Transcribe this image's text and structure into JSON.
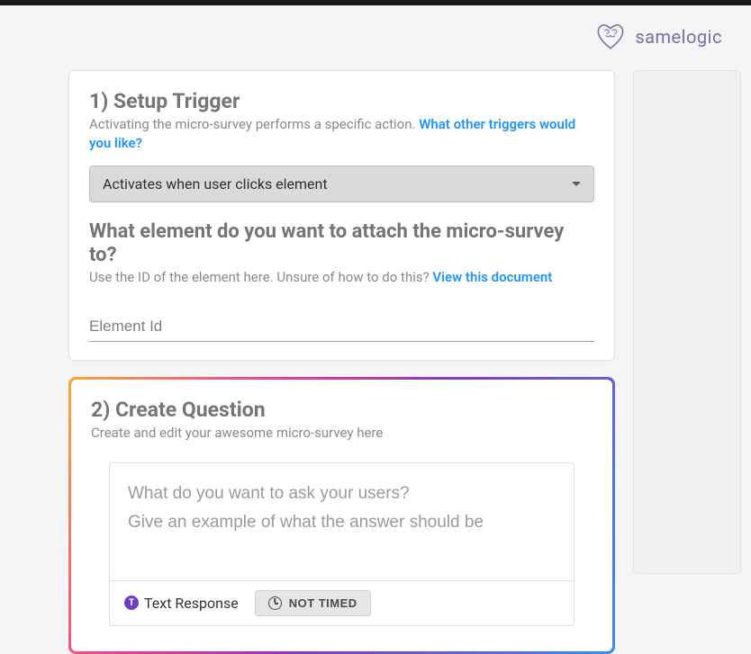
{
  "brand": "samelogic",
  "step1": {
    "title": "1) Setup Trigger",
    "desc": "Activating the micro-survey performs a specific action. ",
    "link": "What other triggers would you like?",
    "dropdown_selected": "Activates when user clicks element",
    "element_header": "What element do you want to attach the micro-survey to?",
    "element_desc": "Use the ID of the element here. Unsure of how to do this? ",
    "element_link": "View this document",
    "element_placeholder": "Element Id"
  },
  "step2": {
    "title": "2) Create Question",
    "desc": "Create and edit your awesome micro-survey here",
    "question_placeholder": "What do you want to ask your users?",
    "hint_placeholder": "Give an example of what the answer should be",
    "type_label": "Text Response",
    "timed_label": "NOT TIMED"
  }
}
